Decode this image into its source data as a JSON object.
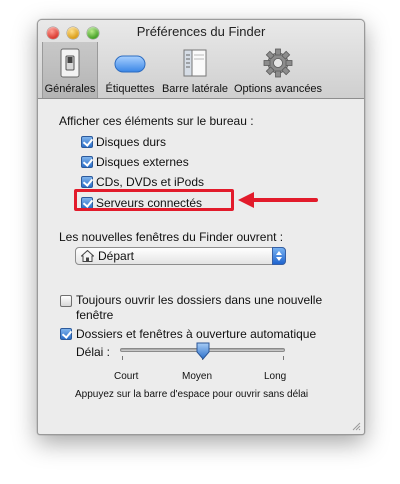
{
  "window": {
    "title": "Préférences du Finder"
  },
  "toolbar": {
    "tabs": [
      {
        "label": "Générales",
        "icon": "light-switch-icon",
        "selected": true
      },
      {
        "label": "Étiquettes",
        "icon": "label-pill-icon",
        "selected": false
      },
      {
        "label": "Barre latérale",
        "icon": "sidebar-icon",
        "selected": false
      },
      {
        "label": "Options avancées",
        "icon": "gear-icon",
        "selected": false
      }
    ]
  },
  "desktop_section": {
    "heading": "Afficher ces éléments sur le bureau :",
    "items": [
      {
        "label": "Disques durs",
        "checked": true
      },
      {
        "label": "Disques externes",
        "checked": true
      },
      {
        "label": "CDs, DVDs et iPods",
        "checked": true
      },
      {
        "label": "Serveurs connectés",
        "checked": true
      }
    ]
  },
  "new_window": {
    "label": "Les nouvelles fenêtres du Finder ouvrent :",
    "selected": "Départ",
    "icon": "home-icon"
  },
  "open_folders": {
    "line1": "Toujours ouvrir les dossiers dans une nouvelle",
    "line2": "fenêtre",
    "checked": false
  },
  "spring_loaded": {
    "label": "Dossiers et fenêtres à ouverture automatique",
    "checked": true,
    "delay_label": "Délai :",
    "ticks": [
      "Court",
      "Moyen",
      "Long"
    ],
    "value": "Moyen",
    "note": "Appuyez sur la barre d'espace pour ouvrir sans délai"
  },
  "colors": {
    "annotation": "#e21b2b",
    "accent": "#2b6fc9"
  }
}
